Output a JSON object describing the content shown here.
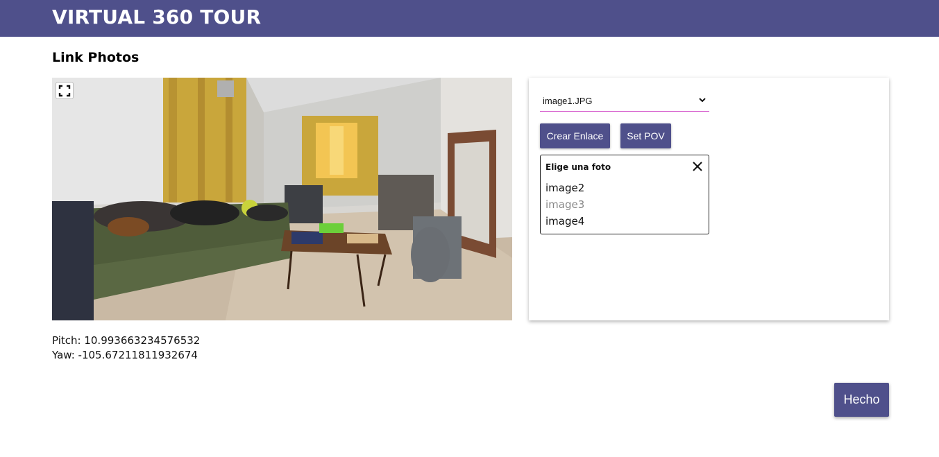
{
  "header": {
    "title": "VIRTUAL 360 TOUR"
  },
  "page": {
    "title": "Link Photos"
  },
  "viewer": {
    "fullscreen_icon": "fullscreen-icon",
    "pitch_label": "Pitch: 10.993663234576532",
    "yaw_label": "Yaw: -105.67211811932674"
  },
  "panel": {
    "photo_select": {
      "selected": "image1.JPG",
      "icon": "chevron-down-icon"
    },
    "create_link_label": "Crear Enlace",
    "set_pov_label": "Set POV",
    "chooser": {
      "title": "Elige una foto",
      "close_icon": "close-icon",
      "items": [
        {
          "label": "image2",
          "disabled": false
        },
        {
          "label": "image3",
          "disabled": true
        },
        {
          "label": "image4",
          "disabled": false
        }
      ]
    }
  },
  "footer": {
    "done_label": "Hecho"
  },
  "colors": {
    "primary": "#4f508b",
    "select_underline": "#d24fc9"
  }
}
